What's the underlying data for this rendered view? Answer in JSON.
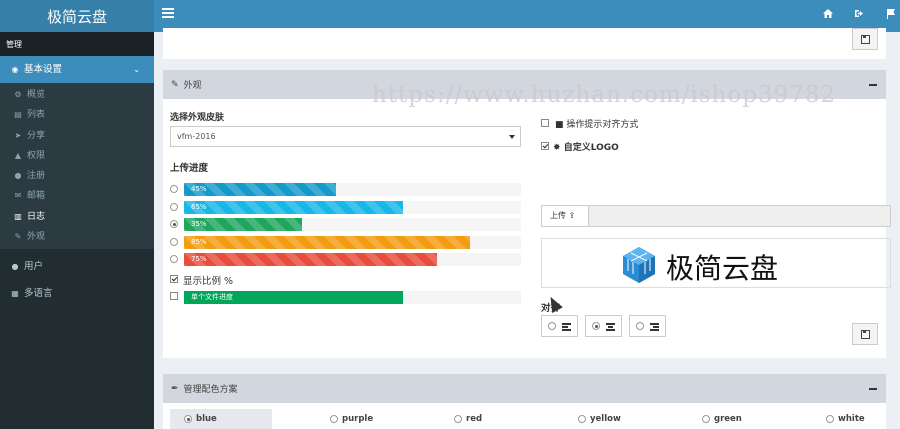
{
  "brand": {
    "title": "极简云盘"
  },
  "topbar": {
    "icons": [
      "home-icon",
      "sign-out-icon",
      "flag-icon"
    ]
  },
  "sidebar": {
    "header": "管理",
    "group_label": "基本设置",
    "sub_items": [
      {
        "label": "概览",
        "icon": "cogs-icon"
      },
      {
        "label": "列表",
        "icon": "list-icon"
      },
      {
        "label": "分享",
        "icon": "send-icon"
      },
      {
        "label": "权限",
        "icon": "graduation-cap-icon"
      },
      {
        "label": "注册",
        "icon": "user-plus-icon"
      },
      {
        "label": "邮箱",
        "icon": "envelope-icon"
      },
      {
        "label": "日志",
        "icon": "bar-chart-icon"
      },
      {
        "label": "外观",
        "icon": "paint-brush-icon"
      }
    ],
    "items": [
      {
        "label": "用户",
        "icon": "users-icon"
      },
      {
        "label": "多语言",
        "icon": "language-icon"
      }
    ]
  },
  "watermark": "https://www.huzhan.com/ishop39782",
  "appearance": {
    "title": "外观",
    "skin_label": "选择外观皮肤",
    "skin_value": "vfm-2016",
    "progress_label": "上传进度",
    "progress_options": [
      {
        "label": "45%",
        "value": 45,
        "color": "#139acb",
        "selected": false
      },
      {
        "label": "65%",
        "value": 65,
        "color": "#17b7e8",
        "selected": false
      },
      {
        "label": "35%",
        "value": 35,
        "color": "#1fa65d",
        "selected": true
      },
      {
        "label": "85%",
        "value": 85,
        "color": "#f39c12",
        "selected": false
      },
      {
        "label": "75%",
        "value": 75,
        "color": "#e74c3c",
        "selected": false
      }
    ],
    "show_percent_label": "显示比例 %",
    "show_percent_checked": true,
    "single_file_label": "单个文件进度",
    "single_file_value": 65,
    "single_file_color": "#00a65a",
    "single_file_checked": false,
    "tooltip_align_label": "操作提示对齐方式",
    "tooltip_align_checked": false,
    "custom_logo_label": "自定义LOGO",
    "custom_logo_checked": true,
    "upload_label": "上传",
    "logo_text": "极简云盘",
    "align_label": "对齐",
    "align_options": [
      {
        "name": "left",
        "selected": false
      },
      {
        "name": "center",
        "selected": true
      },
      {
        "name": "right",
        "selected": false
      }
    ]
  },
  "colors": {
    "title": "管理配色方案",
    "options": [
      "blue",
      "purple",
      "red",
      "yellow",
      "green",
      "white"
    ],
    "selected": "blue"
  }
}
